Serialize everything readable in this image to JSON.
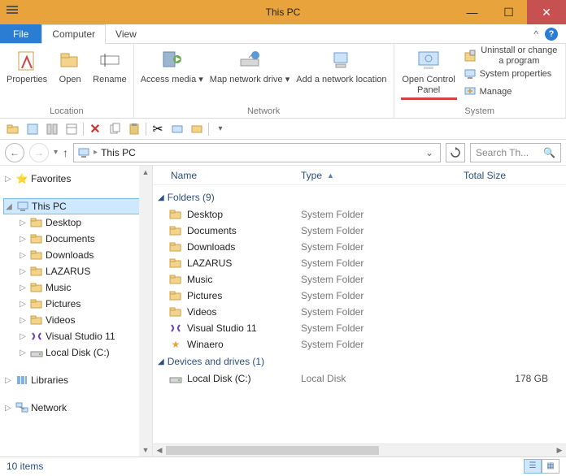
{
  "window": {
    "title": "This PC"
  },
  "tabs": {
    "file": "File",
    "computer": "Computer",
    "view": "View"
  },
  "ribbon": {
    "location": {
      "label": "Location",
      "properties": "Properties",
      "open": "Open",
      "rename": "Rename"
    },
    "network": {
      "label": "Network",
      "access_media": "Access media",
      "map_drive": "Map network drive",
      "add_location": "Add a network location"
    },
    "system": {
      "label": "System",
      "open_control_panel": "Open Control Panel",
      "uninstall": "Uninstall or change a program",
      "sys_props": "System properties",
      "manage": "Manage"
    }
  },
  "address": {
    "location": "This PC"
  },
  "search": {
    "placeholder": "Search Th..."
  },
  "tree": {
    "favorites": "Favorites",
    "thispc": "This PC",
    "children": [
      "Desktop",
      "Documents",
      "Downloads",
      "LAZARUS",
      "Music",
      "Pictures",
      "Videos",
      "Visual Studio 11",
      "Local Disk (C:)"
    ],
    "libraries": "Libraries",
    "network": "Network"
  },
  "columns": {
    "name": "Name",
    "type": "Type",
    "totalsize": "Total Size"
  },
  "groups": {
    "folders": {
      "title": "Folders (9)",
      "items": [
        {
          "name": "Desktop",
          "type": "System Folder",
          "icon": "folder"
        },
        {
          "name": "Documents",
          "type": "System Folder",
          "icon": "folder"
        },
        {
          "name": "Downloads",
          "type": "System Folder",
          "icon": "folder"
        },
        {
          "name": "LAZARUS",
          "type": "System Folder",
          "icon": "folder"
        },
        {
          "name": "Music",
          "type": "System Folder",
          "icon": "folder"
        },
        {
          "name": "Pictures",
          "type": "System Folder",
          "icon": "folder"
        },
        {
          "name": "Videos",
          "type": "System Folder",
          "icon": "folder"
        },
        {
          "name": "Visual Studio 11",
          "type": "System Folder",
          "icon": "vs"
        },
        {
          "name": "Winaero",
          "type": "System Folder",
          "icon": "star"
        }
      ]
    },
    "drives": {
      "title": "Devices and drives (1)",
      "items": [
        {
          "name": "Local Disk (C:)",
          "type": "Local Disk",
          "size": "178 GB",
          "icon": "drive"
        }
      ]
    }
  },
  "status": {
    "count": "10 items"
  }
}
